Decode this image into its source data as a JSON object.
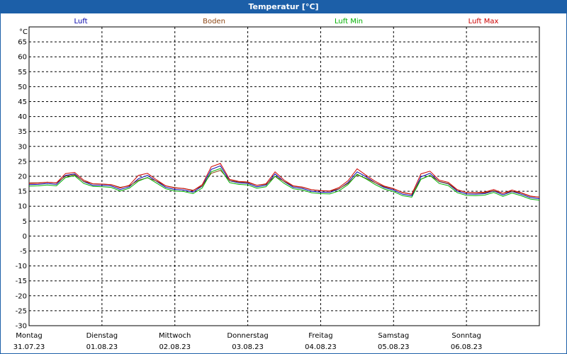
{
  "window": {
    "title": "Temperatur [°C]"
  },
  "legend": [
    {
      "label": "Luft",
      "color": "#0000aa"
    },
    {
      "label": "Boden",
      "color": "#8b4513"
    },
    {
      "label": "Luft Min",
      "color": "#00b000"
    },
    {
      "label": "Luft Max",
      "color": "#cc0000"
    }
  ],
  "chart_data": {
    "type": "line",
    "ylabel": "°C",
    "ylim": [
      -30,
      70
    ],
    "yticks": [
      65,
      60,
      55,
      50,
      45,
      40,
      35,
      30,
      25,
      20,
      15,
      10,
      5,
      0,
      -5,
      -10,
      -15,
      -20,
      -25,
      -30
    ],
    "xlim": [
      0,
      7
    ],
    "grid": true,
    "days": [
      {
        "weekday": "Montag",
        "date": "31.07.23"
      },
      {
        "weekday": "Dienstag",
        "date": "01.08.23"
      },
      {
        "weekday": "Mittwoch",
        "date": "02.08.23"
      },
      {
        "weekday": "Donnerstag",
        "date": "03.08.23"
      },
      {
        "weekday": "Freitag",
        "date": "04.08.23"
      },
      {
        "weekday": "Samstag",
        "date": "05.08.23"
      },
      {
        "weekday": "Sonntag",
        "date": "06.08.23"
      }
    ],
    "x": [
      0,
      0.125,
      0.25,
      0.375,
      0.5,
      0.625,
      0.75,
      0.875,
      1,
      1.125,
      1.25,
      1.375,
      1.5,
      1.625,
      1.75,
      1.875,
      2,
      2.125,
      2.25,
      2.375,
      2.5,
      2.625,
      2.75,
      2.875,
      3,
      3.125,
      3.25,
      3.375,
      3.5,
      3.625,
      3.75,
      3.875,
      4,
      4.125,
      4.25,
      4.375,
      4.5,
      4.625,
      4.75,
      4.875,
      5,
      5.125,
      5.25,
      5.375,
      5.5,
      5.625,
      5.75,
      5.875,
      6,
      6.125,
      6.25,
      6.375,
      6.5,
      6.625,
      6.75,
      6.875,
      7
    ],
    "series": [
      {
        "name": "Luft",
        "color": "#0000aa",
        "values": [
          17.2,
          17.3,
          17.6,
          17.3,
          20.3,
          20.8,
          18.2,
          17.0,
          17.0,
          16.8,
          15.6,
          16.5,
          19.2,
          20.3,
          18.3,
          16.3,
          15.6,
          15.4,
          14.7,
          16.7,
          22.3,
          23.5,
          18.5,
          17.8,
          17.6,
          16.5,
          17.0,
          20.8,
          18.2,
          16.3,
          15.9,
          15.0,
          14.7,
          14.6,
          15.7,
          17.9,
          21.5,
          19.8,
          17.8,
          16.2,
          15.4,
          14.0,
          13.5,
          19.8,
          21.0,
          18.2,
          17.5,
          15.0,
          14.1,
          14.0,
          14.2,
          15.1,
          13.8,
          14.9,
          14.0,
          12.9,
          12.5
        ]
      },
      {
        "name": "Boden",
        "color": "#8b4513",
        "values": [
          17.8,
          17.8,
          18.0,
          17.8,
          20.0,
          20.5,
          18.3,
          17.5,
          17.4,
          17.2,
          16.3,
          16.8,
          18.7,
          19.5,
          18.4,
          16.8,
          16.2,
          15.9,
          15.3,
          16.8,
          21.0,
          22.0,
          18.6,
          18.1,
          17.9,
          17.0,
          17.3,
          20.0,
          18.3,
          16.7,
          16.3,
          15.5,
          15.2,
          15.0,
          15.8,
          17.6,
          20.5,
          19.3,
          17.8,
          16.5,
          15.8,
          14.6,
          14.0,
          19.0,
          20.3,
          18.3,
          17.6,
          15.4,
          14.6,
          14.4,
          14.5,
          15.2,
          14.3,
          15.0,
          14.4,
          13.3,
          13.0
        ]
      },
      {
        "name": "Luft Min",
        "color": "#00b000",
        "values": [
          16.7,
          16.8,
          17.1,
          16.8,
          19.6,
          20.2,
          17.6,
          16.6,
          16.5,
          16.3,
          15.1,
          16.0,
          18.4,
          19.6,
          17.7,
          15.8,
          15.1,
          14.9,
          14.2,
          16.1,
          21.5,
          22.6,
          17.9,
          17.3,
          17.1,
          16.0,
          16.5,
          20.0,
          17.6,
          15.8,
          15.4,
          14.5,
          14.2,
          14.1,
          15.1,
          17.2,
          20.7,
          19.1,
          17.2,
          15.7,
          14.9,
          13.5,
          13.0,
          19.0,
          20.3,
          17.6,
          16.9,
          14.5,
          13.6,
          13.5,
          13.7,
          14.6,
          13.3,
          14.4,
          13.5,
          12.4,
          12.0
        ]
      },
      {
        "name": "Luft Max",
        "color": "#cc0000",
        "values": [
          17.6,
          17.7,
          18.0,
          17.8,
          20.9,
          21.3,
          18.7,
          17.5,
          17.4,
          17.2,
          16.1,
          17.0,
          20.3,
          21.0,
          18.8,
          16.8,
          16.1,
          15.9,
          15.2,
          17.2,
          23.2,
          24.3,
          19.0,
          18.3,
          18.1,
          17.0,
          17.5,
          21.5,
          18.7,
          16.8,
          16.4,
          15.5,
          15.2,
          15.1,
          16.2,
          18.5,
          22.5,
          20.3,
          18.3,
          16.7,
          15.9,
          14.5,
          14.0,
          20.8,
          21.7,
          18.7,
          18.0,
          15.5,
          14.6,
          14.5,
          14.7,
          15.6,
          14.3,
          15.4,
          14.5,
          13.4,
          13.0
        ]
      }
    ]
  }
}
